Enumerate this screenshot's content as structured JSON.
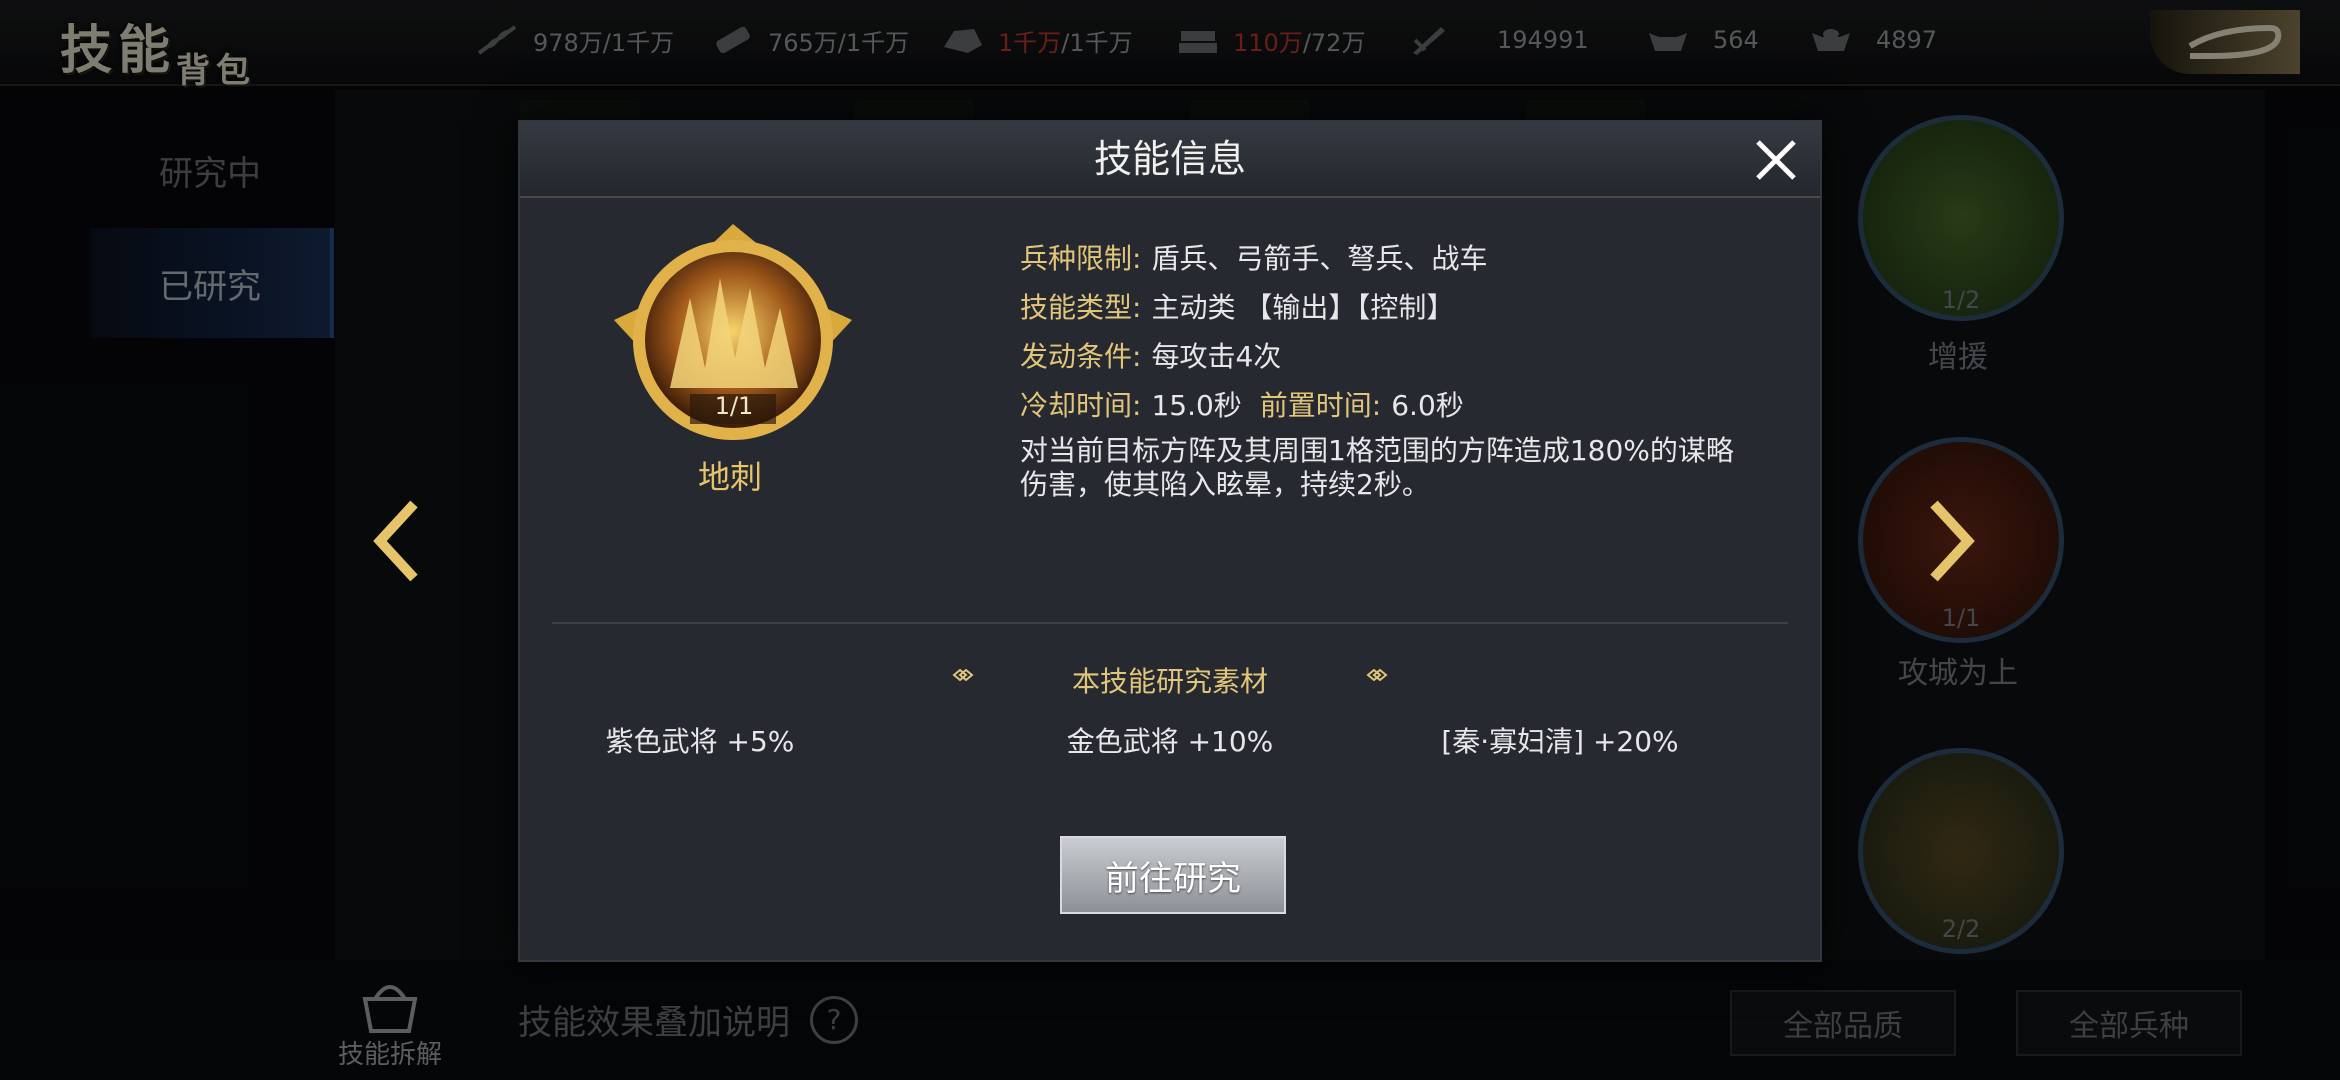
{
  "header": {
    "title_main": "技能",
    "title_sub": "背包",
    "resources": [
      {
        "icon": "grain-icon",
        "value_red": "",
        "value": "978万/1千万"
      },
      {
        "icon": "wood-icon",
        "value_red": "",
        "value": "765万/1千万"
      },
      {
        "icon": "stone-icon",
        "value_red": "1千万",
        "value": "/1千万"
      },
      {
        "icon": "iron-icon",
        "value_red": "110万",
        "value": "/72万"
      },
      {
        "icon": "sword-icon",
        "value_red": "",
        "value": "194991"
      },
      {
        "icon": "silver-ingot-icon",
        "value_red": "",
        "value": "564"
      },
      {
        "icon": "gold-ingot-icon",
        "value_red": "",
        "value": "4897"
      }
    ]
  },
  "sidebar": {
    "tabs": [
      {
        "label": "研究中",
        "active": false
      },
      {
        "label": "已研究",
        "active": true
      }
    ]
  },
  "skill_list": [
    {
      "level": "1/2",
      "name": "增援"
    },
    {
      "level": "1/1",
      "name": "攻城为上"
    },
    {
      "level": "2/2",
      "name": ""
    }
  ],
  "bottom": {
    "dismantle_label": "技能拆解",
    "effects_label": "技能效果叠加说明",
    "help_symbol": "?",
    "filter_quality": "全部品质",
    "filter_troop": "全部兵种"
  },
  "dialog": {
    "title": "技能信息",
    "skill_name": "地刺",
    "skill_level": "1/1",
    "rows": {
      "troop_key": "兵种限制:",
      "troop_val": "盾兵、弓箭手、弩兵、战车",
      "type_key": "技能类型:",
      "type_val": "主动类 【输出】【控制】",
      "trigger_key": "发动条件:",
      "trigger_val": "每攻击4次",
      "cooldown_key": "冷却时间:",
      "cooldown_val": "15.0秒",
      "precast_key": "前置时间:",
      "precast_val": "6.0秒"
    },
    "description": "对当前目标方阵及其周围1格范围的方阵造成180%的谋略伤害，使其陷入眩晕，持续2秒。",
    "materials_title": "本技能研究素材",
    "materials": [
      "紫色武将 +5%",
      "金色武将 +10%",
      "[秦·寡妇清] +20%"
    ],
    "go_button": "前往研究"
  },
  "colors": {
    "accent_gold": "#e1c57a",
    "dialog_bg": "#262a30",
    "active_tab": "#142646"
  }
}
